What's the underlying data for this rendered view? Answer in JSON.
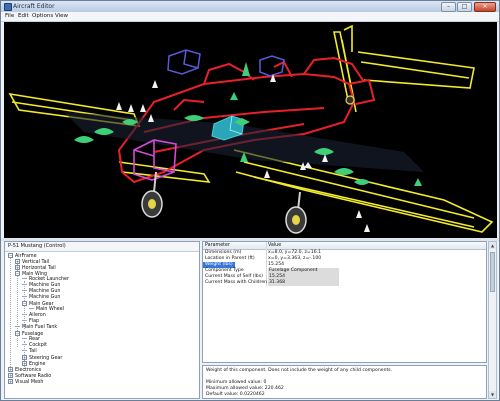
{
  "window": {
    "title": "Aircraft Editor",
    "buttons": {
      "minimize": "–",
      "maximize": "□",
      "close": "✕"
    }
  },
  "menu": [
    "File",
    "Edit",
    "Options",
    "View"
  ],
  "tree": {
    "header": "P-51 Mustang (Control)",
    "items": [
      {
        "label": "AirFrame",
        "level": 0,
        "toggle": "−"
      },
      {
        "label": "Vertical Tail",
        "level": 1,
        "toggle": "+"
      },
      {
        "label": "Horizontal Tail",
        "level": 1,
        "toggle": "+"
      },
      {
        "label": "Main Wing",
        "level": 1,
        "toggle": "−"
      },
      {
        "label": "Rocket Launcher",
        "level": 2,
        "toggle": ""
      },
      {
        "label": "Machine Gun",
        "level": 2,
        "toggle": ""
      },
      {
        "label": "Machine Gun",
        "level": 2,
        "toggle": ""
      },
      {
        "label": "Machine Gun",
        "level": 2,
        "toggle": ""
      },
      {
        "label": "Main Gear",
        "level": 2,
        "toggle": "−"
      },
      {
        "label": "Main Wheel",
        "level": 3,
        "toggle": ""
      },
      {
        "label": "Aileron",
        "level": 2,
        "toggle": ""
      },
      {
        "label": "Flap",
        "level": 2,
        "toggle": ""
      },
      {
        "label": "Main Fuel Tank",
        "level": 1,
        "toggle": ""
      },
      {
        "label": "Fuselage",
        "level": 1,
        "toggle": "−"
      },
      {
        "label": "Rear",
        "level": 2,
        "toggle": ""
      },
      {
        "label": "Cockpit",
        "level": 2,
        "toggle": ""
      },
      {
        "label": "Tail",
        "level": 2,
        "toggle": ""
      },
      {
        "label": "Steering Gear",
        "level": 2,
        "toggle": "+"
      },
      {
        "label": "Engine",
        "level": 2,
        "toggle": "+"
      },
      {
        "label": "Electronics",
        "level": 0,
        "toggle": "+"
      },
      {
        "label": "Software Radio",
        "level": 0,
        "toggle": "+"
      },
      {
        "label": "Visual Mesh",
        "level": 0,
        "toggle": "+"
      }
    ]
  },
  "properties": {
    "header_name": "Parameter",
    "header_value": "Value",
    "rows": [
      {
        "name": "Dimensions (m)",
        "value": "x=8.0, y=72.0, z=16.1",
        "state": "normal"
      },
      {
        "name": "Location in Parent (ft)",
        "value": "x=0, y=3.363, z=-.100",
        "state": "normal"
      },
      {
        "name": "Weight (lbs)",
        "value": "15.254",
        "state": "selected"
      },
      {
        "name": "Component Type",
        "value": "Fuselage Component",
        "state": "readonly"
      },
      {
        "name": "Current Mass of Self (lbs)",
        "value": "15.254",
        "state": "readonly"
      },
      {
        "name": "Current Mass with Children (lbs)",
        "value": "31.368",
        "state": "readonly"
      }
    ]
  },
  "description": {
    "text": "Weight of this component. Does not include the weight of any child components.",
    "min": "Minimum allowed value: 0",
    "max": "Maximum allowed value: 220.462",
    "default": "Default value: 0.0220462"
  },
  "scrollbar": {
    "up": "▲",
    "down": "▼"
  },
  "colors": {
    "wireframe_red": "#e8202a",
    "wireframe_yellow": "#f2ea2c",
    "component_magenta": "#d34bd6",
    "component_blue": "#5a5ad8",
    "component_cyan": "#40d0d0",
    "marker_green": "#3fcf79",
    "selection_blue": "#3875d7"
  }
}
